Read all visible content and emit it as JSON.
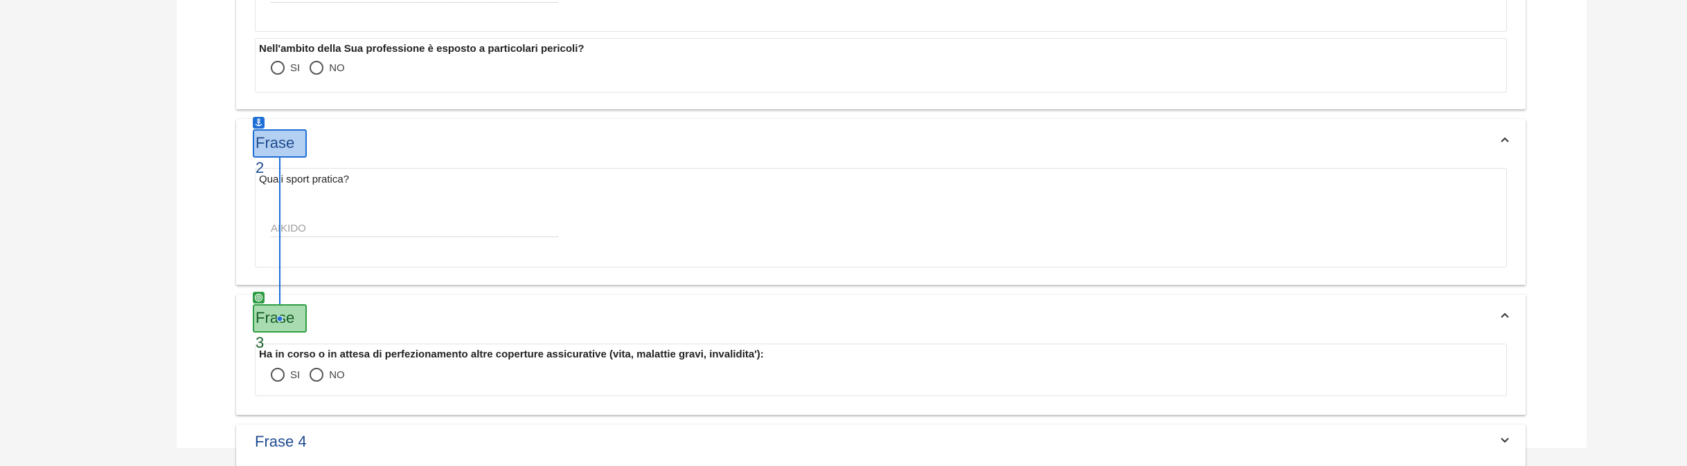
{
  "sections": [
    {
      "question": "Nell'ambito della Sua professione è esposto a particolari pericoli?",
      "options": [
        "SI",
        "NO"
      ]
    },
    {
      "title": "Frase 2",
      "question": "Quali sport pratica?",
      "answer": "AIKIDO"
    },
    {
      "title": "Frase 3",
      "question": "Ha in corso o in attesa di perfezionamento altre coperture assicurative (vita, malattie gravi, invalidita'):",
      "options": [
        "SI",
        "NO"
      ]
    },
    {
      "title": "Frase 4"
    }
  ],
  "annotations": {
    "anchor_icon": "anchor-icon",
    "target_icon": "target-icon",
    "anchor_color": "#1f6fd6",
    "target_color": "#2e9d44"
  }
}
